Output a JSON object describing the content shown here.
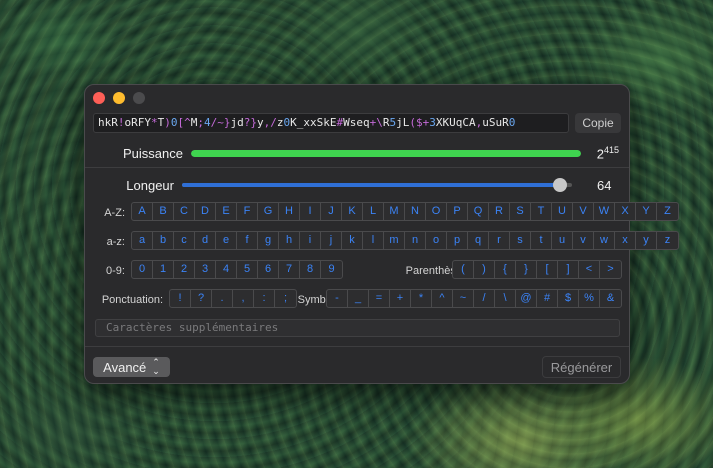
{
  "password": {
    "segments": [
      {
        "t": "hkR",
        "c": "n"
      },
      {
        "t": "!",
        "c": "s"
      },
      {
        "t": "oRFY",
        "c": "n"
      },
      {
        "t": "*",
        "c": "s"
      },
      {
        "t": "T",
        "c": "n"
      },
      {
        "t": ")",
        "c": "s"
      },
      {
        "t": "0",
        "c": "d"
      },
      {
        "t": "[^",
        "c": "s"
      },
      {
        "t": "M",
        "c": "n"
      },
      {
        "t": ";",
        "c": "s"
      },
      {
        "t": "4",
        "c": "d"
      },
      {
        "t": "/~",
        "c": "s"
      },
      {
        "t": "}",
        "c": "s"
      },
      {
        "t": "jd",
        "c": "n"
      },
      {
        "t": "?",
        "c": "s"
      },
      {
        "t": "}",
        "c": "s"
      },
      {
        "t": "y",
        "c": "n"
      },
      {
        "t": ",/",
        "c": "s"
      },
      {
        "t": "z",
        "c": "n"
      },
      {
        "t": "0",
        "c": "d"
      },
      {
        "t": "K_xxSkE",
        "c": "n"
      },
      {
        "t": "#",
        "c": "s"
      },
      {
        "t": "Wseq",
        "c": "n"
      },
      {
        "t": "+\\",
        "c": "s"
      },
      {
        "t": "R",
        "c": "n"
      },
      {
        "t": "5",
        "c": "d"
      },
      {
        "t": "jL",
        "c": "n"
      },
      {
        "t": "(",
        "c": "s"
      },
      {
        "t": "$",
        "c": "s"
      },
      {
        "t": "+",
        "c": "s"
      },
      {
        "t": "3",
        "c": "d"
      },
      {
        "t": "XKUqCA",
        "c": "n"
      },
      {
        "t": ",",
        "c": "s"
      },
      {
        "t": "uSuR",
        "c": "n"
      },
      {
        "t": "0",
        "c": "d"
      }
    ],
    "copy_label": "Copie"
  },
  "strength": {
    "label": "Puissance",
    "value_base": "2",
    "value_exp": "415",
    "fill_fraction": 1.0
  },
  "length": {
    "label": "Longeur",
    "value": "64",
    "min": 1,
    "max": 64,
    "current": 64
  },
  "uppercase": {
    "label": "A-Z:",
    "keys": [
      "A",
      "B",
      "C",
      "D",
      "E",
      "F",
      "G",
      "H",
      "I",
      "J",
      "K",
      "L",
      "M",
      "N",
      "O",
      "P",
      "Q",
      "R",
      "S",
      "T",
      "U",
      "V",
      "W",
      "X",
      "Y",
      "Z"
    ]
  },
  "lowercase": {
    "label": "a-z:",
    "keys": [
      "a",
      "b",
      "c",
      "d",
      "e",
      "f",
      "g",
      "h",
      "i",
      "j",
      "k",
      "l",
      "m",
      "n",
      "o",
      "p",
      "q",
      "r",
      "s",
      "t",
      "u",
      "v",
      "w",
      "x",
      "y",
      "z"
    ]
  },
  "digits": {
    "label": "0-9:",
    "keys": [
      "0",
      "1",
      "2",
      "3",
      "4",
      "5",
      "6",
      "7",
      "8",
      "9"
    ]
  },
  "brackets": {
    "label": "Parenthèse:",
    "keys": [
      "(",
      ")",
      "{",
      "}",
      "[",
      "]",
      "<",
      ">"
    ]
  },
  "punctuation": {
    "label": "Ponctuation:",
    "keys": [
      "!",
      "?",
      ".",
      ",",
      ":",
      ";"
    ]
  },
  "symbols": {
    "label": "Symboles:",
    "keys": [
      "-",
      "_",
      "=",
      "+",
      "*",
      "^",
      "~",
      "/",
      "\\",
      "@",
      "#",
      "$",
      "%",
      "&"
    ]
  },
  "extra": {
    "placeholder": "Caractères supplémentaires"
  },
  "footer": {
    "advanced_label": "Avancé",
    "regenerate_label": "Régénérer"
  },
  "colors": {
    "strength_fill": "#3fd44f",
    "slider_fill": "#2f6fd6",
    "key_text": "#3b83f6",
    "symbol_text": "#c46ad8",
    "digit_text": "#6aa7f0"
  }
}
